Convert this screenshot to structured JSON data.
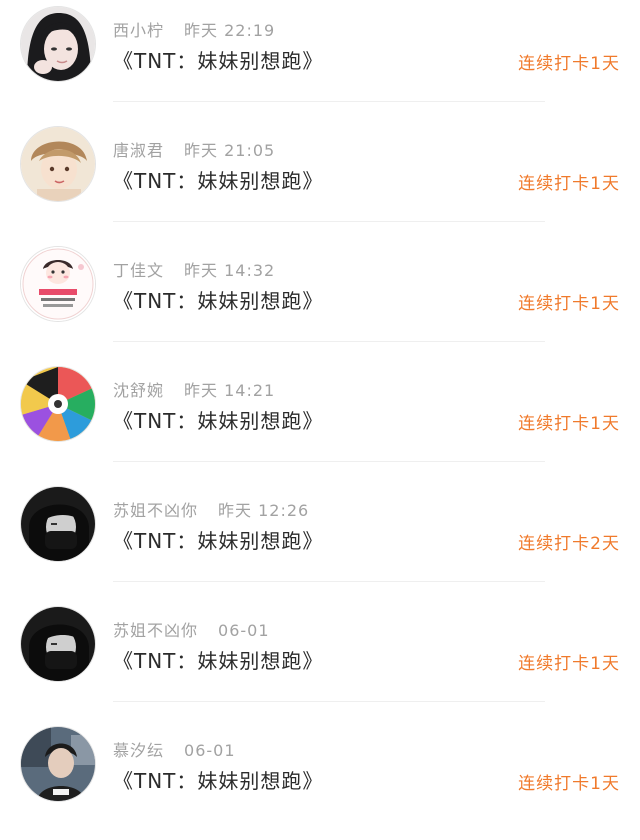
{
  "items": [
    {
      "name": "西小柠",
      "time": "昨天 22:19",
      "title": "《TNT：妹妹别想跑》",
      "streak": "连续打卡1天",
      "avatar": "avatar-girl-photo"
    },
    {
      "name": "唐淑君",
      "time": "昨天 21:05",
      "title": "《TNT：妹妹别想跑》",
      "streak": "连续打卡1天",
      "avatar": "avatar-illustrated-boy"
    },
    {
      "name": "丁佳文",
      "time": "昨天 14:32",
      "title": "《TNT：妹妹别想跑》",
      "streak": "连续打卡1天",
      "avatar": "avatar-cartoon-sticker"
    },
    {
      "name": "沈舒婉",
      "time": "昨天 14:21",
      "title": "《TNT：妹妹别想跑》",
      "streak": "连续打卡1天",
      "avatar": "avatar-colorful-collage"
    },
    {
      "name": "苏姐不凶你",
      "time": "昨天 12:26",
      "title": "《TNT：妹妹别想跑》",
      "streak": "连续打卡2天",
      "avatar": "avatar-dark-masked-photo"
    },
    {
      "name": "苏姐不凶你",
      "time": "06-01",
      "title": "《TNT：妹妹别想跑》",
      "streak": "连续打卡1天",
      "avatar": "avatar-dark-masked-photo"
    },
    {
      "name": "慕汐纭",
      "time": "06-01",
      "title": "《TNT：妹妹别想跑》",
      "streak": "连续打卡1天",
      "avatar": "avatar-boy-photo"
    }
  ],
  "colors": {
    "accent": "#f07a2c",
    "meta": "#a2a2a2",
    "title": "#2b2b2b",
    "divider": "#efefef"
  }
}
